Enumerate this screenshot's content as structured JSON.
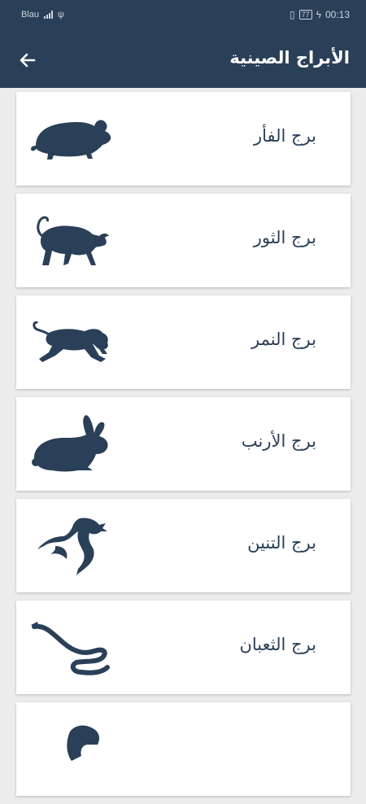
{
  "status": {
    "carrier": "Blau",
    "battery": "77",
    "time": "00:13"
  },
  "header": {
    "title": "الأبراج الصينية",
    "back_icon": "arrow-left-icon"
  },
  "colors": {
    "primary": "#2a3f58",
    "background": "#ececec",
    "card": "#ffffff"
  },
  "zodiac": [
    {
      "label": "برج الفأر",
      "icon": "rat-icon"
    },
    {
      "label": "برج الثور",
      "icon": "ox-icon"
    },
    {
      "label": "برج النمر",
      "icon": "tiger-icon"
    },
    {
      "label": "برج الأرنب",
      "icon": "rabbit-icon"
    },
    {
      "label": "برج التنين",
      "icon": "dragon-icon"
    },
    {
      "label": "برج الثعبان",
      "icon": "snake-icon"
    },
    {
      "label": "",
      "icon": "horse-icon"
    }
  ]
}
